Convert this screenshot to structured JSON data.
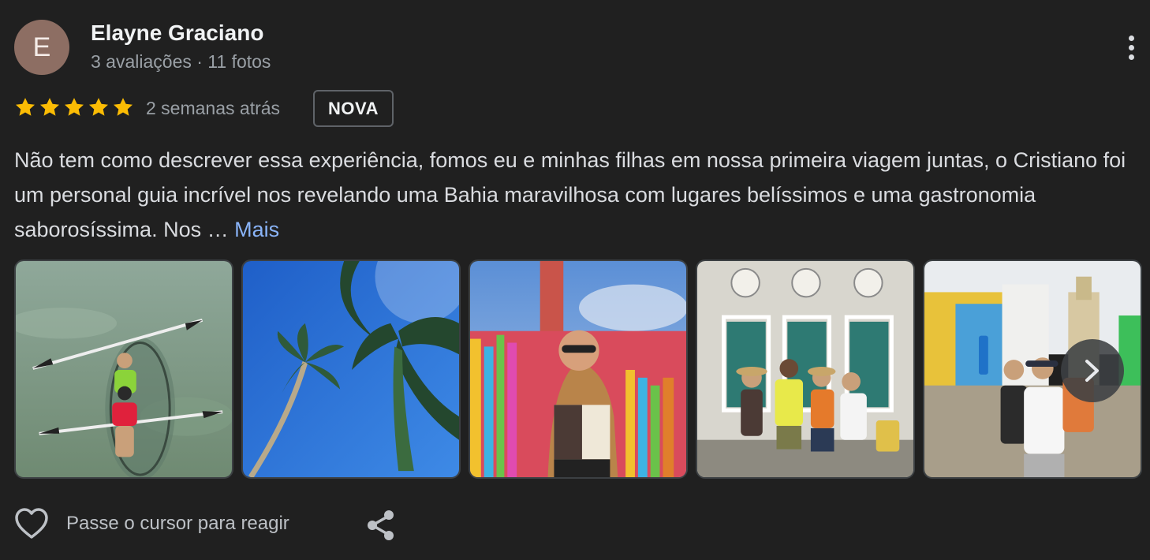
{
  "author": {
    "initial": "E",
    "name": "Elayne Graciano",
    "meta": "3 avaliações · 11 fotos",
    "avatar_color": "#8d6e63"
  },
  "review": {
    "rating": 5,
    "time": "2 semanas atrás",
    "badge": "NOVA",
    "text": "Não tem como descrever essa experiência, fomos eu e minhas filhas em nossa primeira viagem juntas, o Cristiano foi um personal guia incrível nos revelando uma Bahia maravilhosa com lugares belíssimos e uma gastronomia saborosíssima. Nos …",
    "more_label": "Mais"
  },
  "photos": [
    {
      "icon": "kayak-photo"
    },
    {
      "icon": "palm-trees-photo"
    },
    {
      "icon": "ribbons-photo"
    },
    {
      "icon": "group-photo"
    },
    {
      "icon": "selfie-photo"
    }
  ],
  "actions": {
    "react_label": "Passe o cursor para reagir",
    "share_icon": "share-icon",
    "heart_icon": "heart-icon",
    "menu_icon": "more-vert-icon"
  },
  "colors": {
    "background": "#202020",
    "star": "#fbbc04",
    "link": "#8ab4f8",
    "secondary_text": "#9aa0a6"
  }
}
